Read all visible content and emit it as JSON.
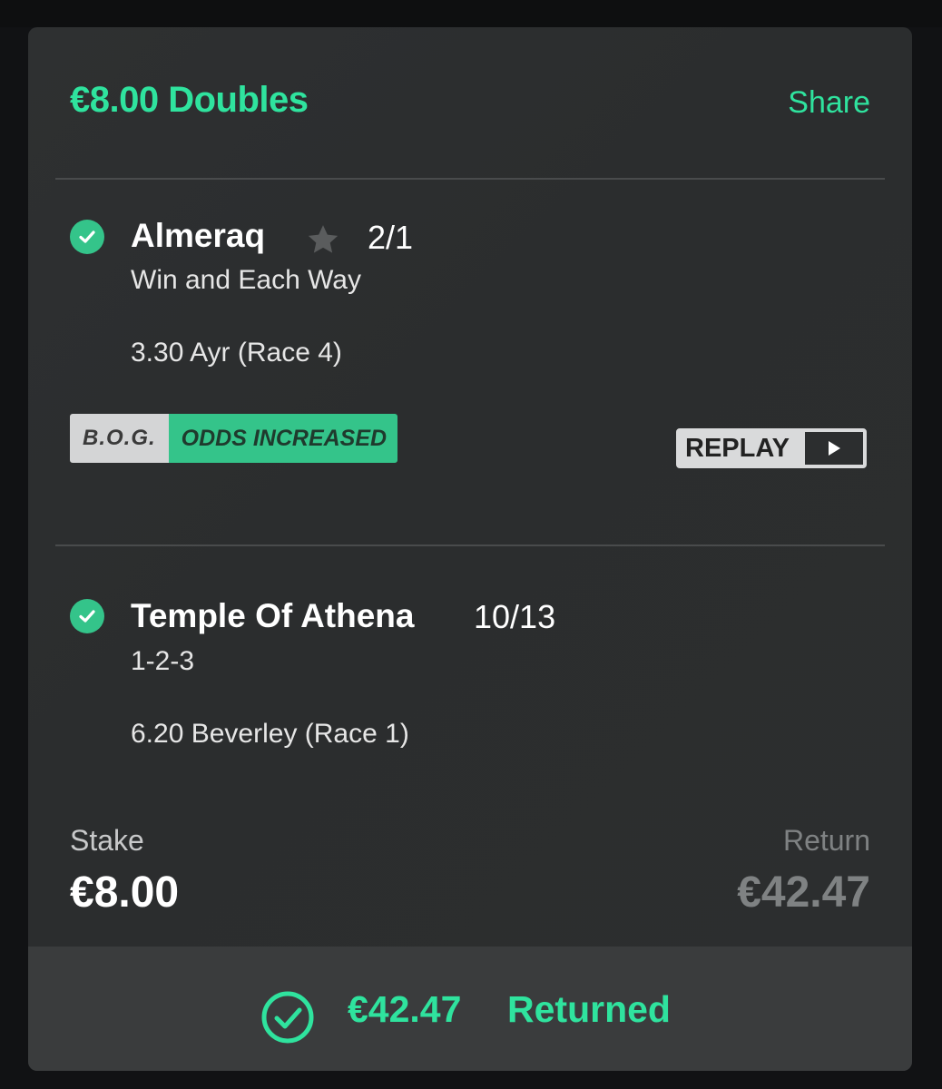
{
  "bet": {
    "title": "€8.00 Doubles",
    "share_label": "Share"
  },
  "selections": [
    {
      "name": "Almeraq",
      "odds": "2/1",
      "market": "Win and Each Way",
      "race": "3.30 Ayr (Race 4)",
      "status_icon": "check-circle-icon",
      "favourite_icon": "star-icon"
    },
    {
      "name": "Temple Of Athena",
      "odds": "10/13",
      "market": "1-2-3",
      "race": "6.20 Beverley (Race 1)",
      "status_icon": "check-circle-icon"
    }
  ],
  "badge": {
    "left": "B.O.G.",
    "right": "ODDS INCREASED"
  },
  "replay": {
    "label": "REPLAY",
    "icon": "play-icon"
  },
  "summary": {
    "stake_label": "Stake",
    "stake_value": "€8.00",
    "return_label": "Return",
    "return_value": "€42.47"
  },
  "returned": {
    "amount": "€42.47",
    "label": "Returned",
    "icon": "check-circle-outline-icon"
  },
  "colors": {
    "accent": "#2fe39e",
    "check": "#34c48a",
    "card": "#2e3031",
    "footer": "#3a3c3d"
  }
}
